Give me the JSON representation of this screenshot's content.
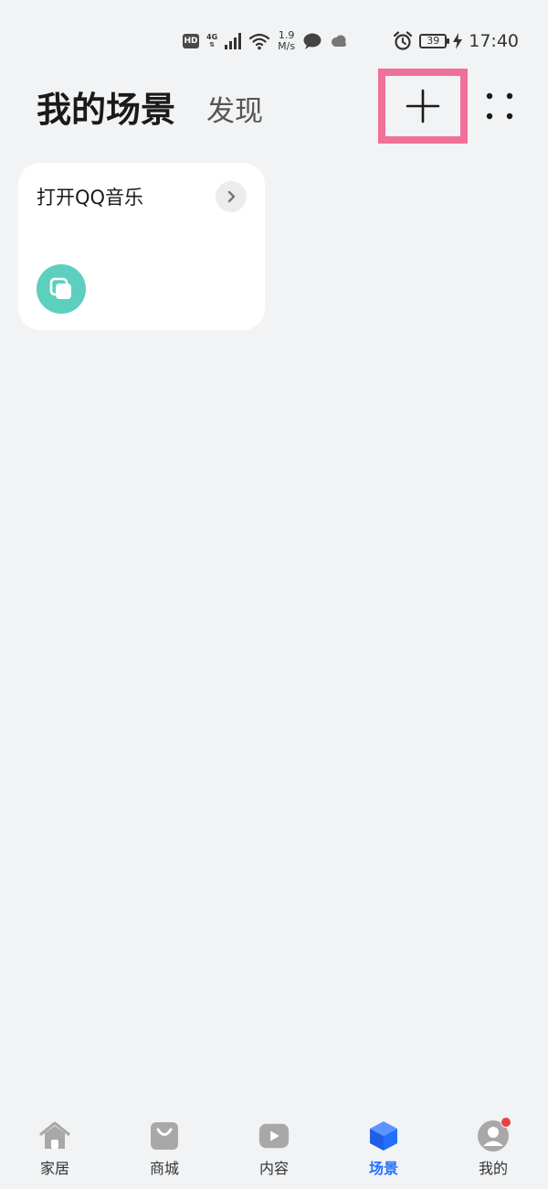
{
  "status_bar": {
    "hd": "HD",
    "network": "4G",
    "speed_value": "1.9",
    "speed_unit": "M/s",
    "battery": "39",
    "time": "17:40"
  },
  "header": {
    "title": "我的场景",
    "discover": "发现"
  },
  "scene_card": {
    "title": "打开QQ音乐",
    "icon_color": "#5dcfbe"
  },
  "bottom_nav": {
    "home": "家居",
    "mall": "商城",
    "content": "内容",
    "scenes": "场景",
    "me": "我的"
  },
  "colors": {
    "background": "#f1f3f5",
    "highlight": "#f07098",
    "active": "#256fff",
    "inactive_icon": "#a8a8a8",
    "notification": "#e84040"
  }
}
